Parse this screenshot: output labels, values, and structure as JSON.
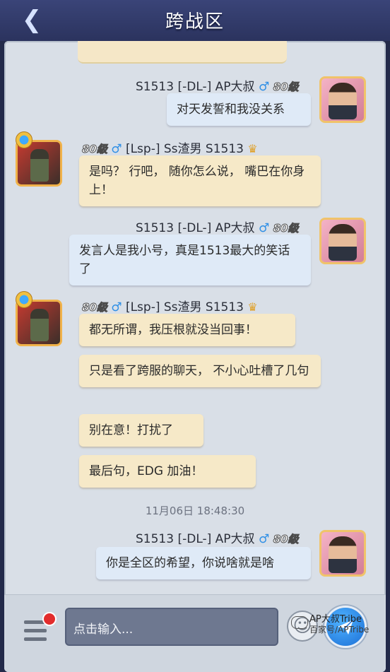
{
  "header": {
    "title": "跨战区",
    "back_icon": "chevron-left-icon"
  },
  "messages": [
    {
      "side": "mine",
      "name": "S1513 [-DL-] AP大叔",
      "gender": "♂",
      "level": "80级",
      "text": "对天发誓和我没关系"
    },
    {
      "side": "theirs",
      "name": "[Lsp-] Ss渣男 S1513",
      "gender": "♂",
      "level": "80级",
      "texts": [
        "是吗？ 行吧， 随你怎么说， 嘴巴在你身上！"
      ]
    },
    {
      "side": "mine",
      "name": "S1513 [-DL-] AP大叔",
      "gender": "♂",
      "level": "80级",
      "text": "发言人是我小号，真是1513最大的笑话了"
    },
    {
      "side": "theirs",
      "name": "[Lsp-] Ss渣男 S1513",
      "gender": "♂",
      "level": "80级",
      "texts": [
        "都无所谓，我压根就没当回事！",
        "只是看了跨服的聊天， 不小心吐槽了几句",
        "别在意！打扰了",
        "最后句，EDG 加油！"
      ]
    },
    {
      "side": "mine",
      "name": "S1513 [-DL-] AP大叔",
      "gender": "♂",
      "level": "80级",
      "text": "你是全区的希望，你说啥就是啥"
    }
  ],
  "timestamp": "11月06日 18:48:30",
  "input": {
    "placeholder": "点击输入..."
  },
  "watermark": {
    "line1": "AP大叔Tribe",
    "line2": "百家号/APTribe"
  },
  "colors": {
    "mine_bubble": "#dfeaf7",
    "theirs_bubble": "#f6e9c8",
    "send": "#1b6fd6",
    "notice_dot": "#e22c2c"
  }
}
